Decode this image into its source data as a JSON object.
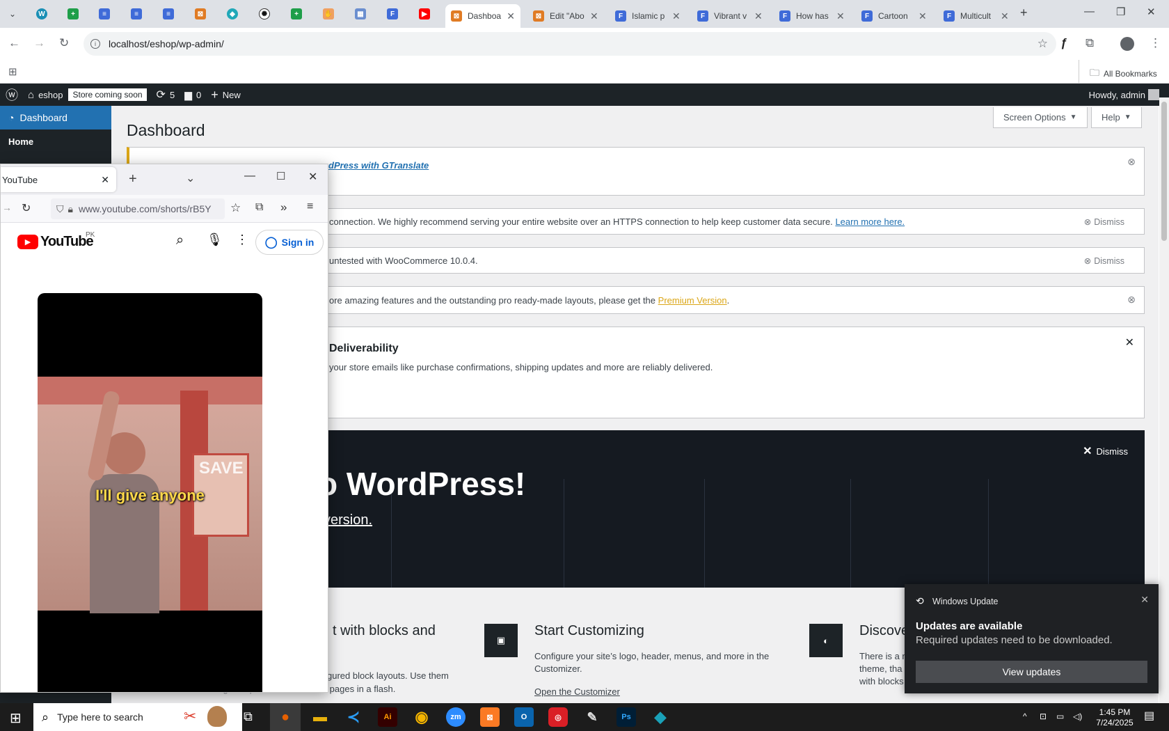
{
  "browser": {
    "tabs": [
      {
        "label": "Dashboa",
        "color": "#e07b24"
      },
      {
        "label": "Edit \"Abo",
        "color": "#e07b24"
      },
      {
        "label": "Islamic p",
        "color": "#3f6bd8"
      },
      {
        "label": "Vibrant v",
        "color": "#3f6bd8"
      },
      {
        "label": "How has",
        "color": "#3f6bd8"
      },
      {
        "label": "Cartoon",
        "color": "#3f6bd8"
      },
      {
        "label": "Multicult",
        "color": "#3f6bd8"
      }
    ],
    "url": "localhost/eshop/wp-admin/",
    "all_bookmarks": "All Bookmarks"
  },
  "adminbar": {
    "site": "eshop",
    "store_badge": "Store coming soon",
    "updates": "5",
    "comments": "0",
    "new": "New",
    "howdy": "Howdy, admin"
  },
  "sidebar": {
    "dashboard": "Dashboard",
    "home": "Home"
  },
  "main": {
    "title": "Dashboard",
    "screen_options": "Screen Options",
    "help": "Help",
    "notice1_link": "dPress with GTranslate",
    "notice2_text": "connection. We highly recommend serving your entire website over an HTTPS connection to help keep customer data secure.",
    "notice2_link": "Learn more here.",
    "dismiss": "Dismiss",
    "notice3_text": "untested with WooCommerce 10.0.4.",
    "notice4_text": "ore amazing features and the outstanding pro ready-made layouts, please get the",
    "notice4_link": "Premium Version",
    "deliv_title": "Deliverability",
    "deliv_text": "your store emails like purchase confirmations, shipping updates and more are reliably delivered.",
    "welcome_heading": "o WordPress!",
    "welcome_version": "version.",
    "welcome_dismiss": "Dismiss",
    "card1_title": "t with blocks and",
    "card1_text_a": "gured block layouts. Use them",
    "card1_text_b": "w pages in a flash.",
    "card2_title": "Start Customizing",
    "card2_text": "Configure your site’s logo, header, menus, and more in the Customizer.",
    "card2_link": "Open the Customizer",
    "card3_title": "Discove",
    "card3_text_a": "There is a n",
    "card3_text_b": "theme, tha",
    "card3_text_c": "with blocks"
  },
  "firefox": {
    "tab_title": "YouTube",
    "url": "www.youtube.com/shorts/rB5Y",
    "region": "PK",
    "brand": "YouTube",
    "sign_in": "Sign in",
    "caption": "I'll give anyone",
    "sign_text": "SAVE"
  },
  "toast": {
    "app": "Windows Update",
    "title": "Updates are available",
    "body": "Required updates need to be downloaded.",
    "button": "View updates"
  },
  "taskbar": {
    "search_placeholder": "Type here to search",
    "time": "1:45 PM",
    "date": "7/24/2025",
    "apps": [
      {
        "name": "firefox",
        "color": "#e66000",
        "glyph": "●"
      },
      {
        "name": "file-explorer",
        "color": "#e8b10c",
        "glyph": "▬"
      },
      {
        "name": "vscode",
        "color": "#0078d4",
        "glyph": "≺"
      },
      {
        "name": "illustrator",
        "color": "#330000",
        "glyph": "Ai"
      },
      {
        "name": "chrome",
        "color": "#34a853",
        "glyph": "◉"
      },
      {
        "name": "zoom",
        "color": "#2d8cff",
        "glyph": "zm"
      },
      {
        "name": "xampp",
        "color": "#fb7a24",
        "glyph": "⊠"
      },
      {
        "name": "outlook",
        "color": "#0a64ad",
        "glyph": "O"
      },
      {
        "name": "creative-cloud",
        "color": "#da1f26",
        "glyph": "◎"
      },
      {
        "name": "pen-tool",
        "color": "#333333",
        "glyph": "✎"
      },
      {
        "name": "photoshop",
        "color": "#001e36",
        "glyph": "Ps"
      },
      {
        "name": "app-blue",
        "color": "#1aa1b8",
        "glyph": "◆"
      }
    ]
  }
}
